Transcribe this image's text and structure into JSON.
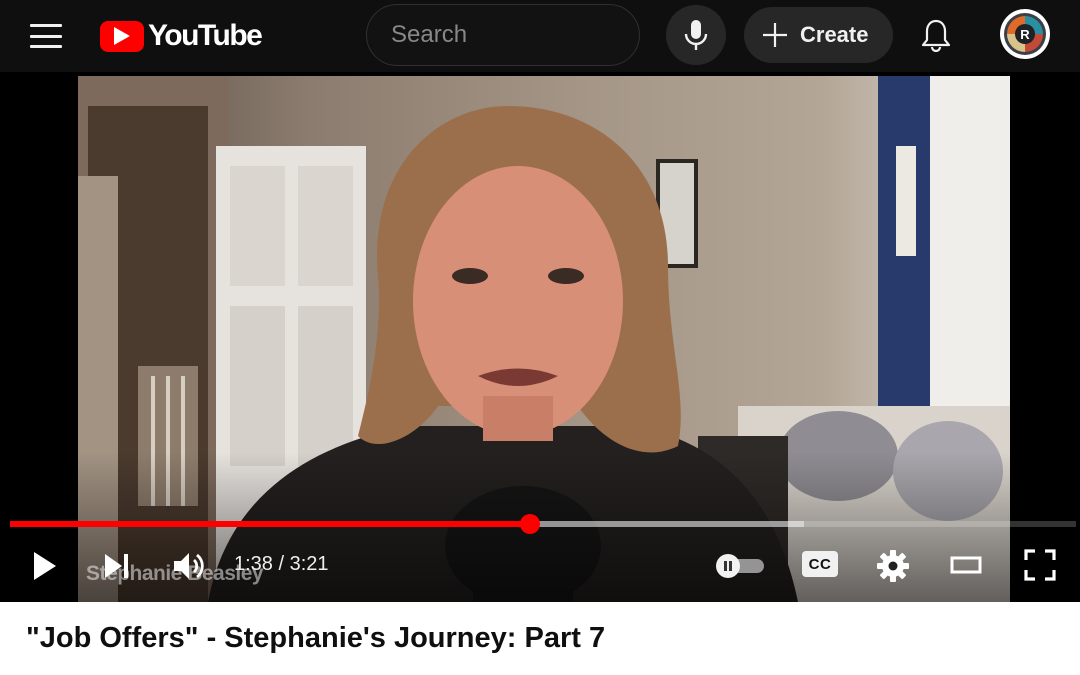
{
  "app": {
    "logo_text": "YouTube",
    "brand_color": "#ff0000",
    "background_color": "#0f0f0f"
  },
  "header": {
    "menu_icon": "hamburger-menu-icon",
    "search": {
      "placeholder": "Search",
      "value": ""
    },
    "search_icon": "search-icon",
    "mic_icon": "microphone-icon",
    "create_label": "Create",
    "create_icon": "plus-icon",
    "notifications_icon": "bell-icon",
    "avatar_letter": "R"
  },
  "player": {
    "watermark": "Stephanie Beasley",
    "current_time": "1:38",
    "duration": "3:21",
    "time_display": "1:38 / 3:21",
    "progress_fraction": 0.488,
    "buffered_fraction": 0.745,
    "progress_color": "#ff0000",
    "controls": {
      "play_icon": "play-icon",
      "next_icon": "next-icon",
      "volume_icon": "volume-icon",
      "autoplay_icon": "autoplay-pause-icon",
      "autoplay_on": false,
      "cc_label": "CC",
      "settings_icon": "gear-icon",
      "theater_icon": "theater-mode-icon",
      "fullscreen_icon": "fullscreen-icon"
    }
  },
  "video": {
    "title": "\"Job Offers\" - Stephanie's Journey: Part 7"
  }
}
